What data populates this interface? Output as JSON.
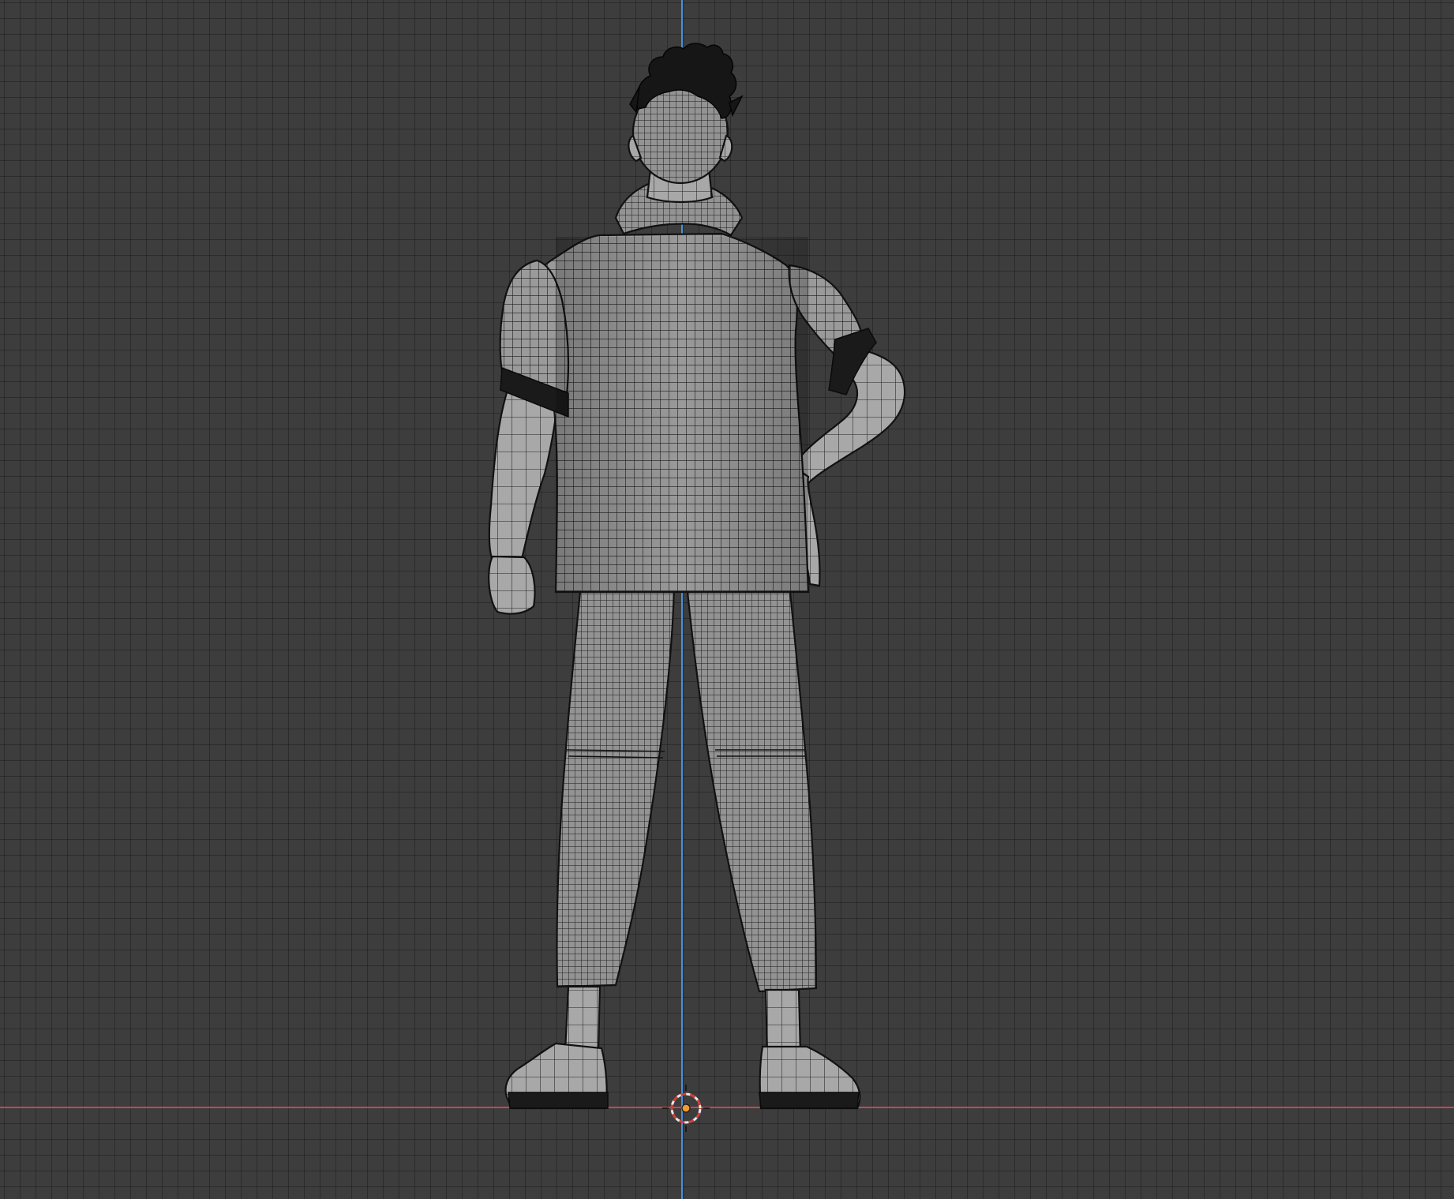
{
  "viewport": {
    "view": "back-orthographic",
    "grid": true,
    "background_color": "#3d3d3d",
    "grid_color": "#2e2e2e",
    "x_axis_color": "#c8464f",
    "z_axis_color": "#4a8fd8"
  },
  "scene": {
    "object": "character-mesh",
    "shading": "solid-with-wireframe",
    "cursor_icon": "3d-cursor-icon",
    "origin_icon": "object-origin-icon"
  }
}
